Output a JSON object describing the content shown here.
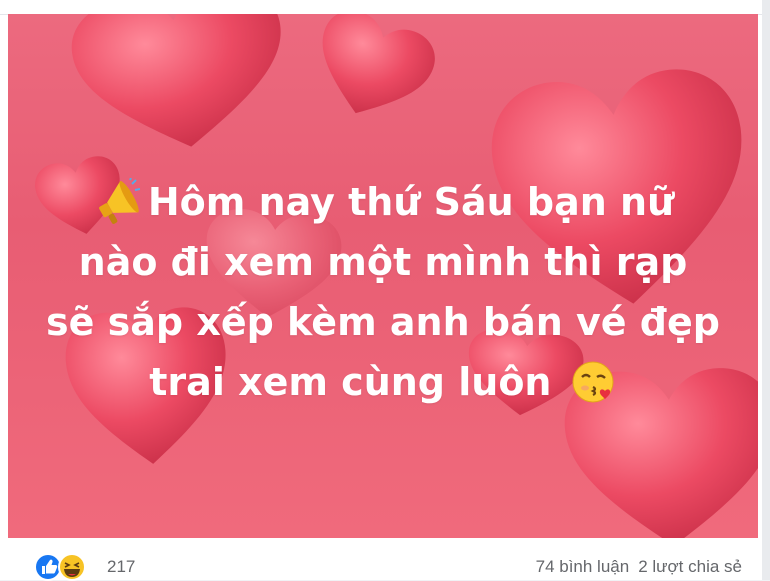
{
  "post": {
    "caption_lines": [
      "Hôm nay thứ Sáu bạn nữ",
      "nào đi xem một mình thì rạp",
      "sẽ sắp xếp kèm anh bán vé đẹp",
      "trai xem cùng luôn"
    ],
    "caption_lead_icon": "megaphone-icon",
    "caption_trail_icon": "kissing-face-emoji",
    "background_color": "#e85d73",
    "heart_color": "#e24661"
  },
  "footer": {
    "reaction_icons": [
      "like-icon",
      "haha-icon"
    ],
    "reaction_count": "217",
    "comments_label": "74 bình luận",
    "shares_label": "2 lượt chia sẻ"
  }
}
